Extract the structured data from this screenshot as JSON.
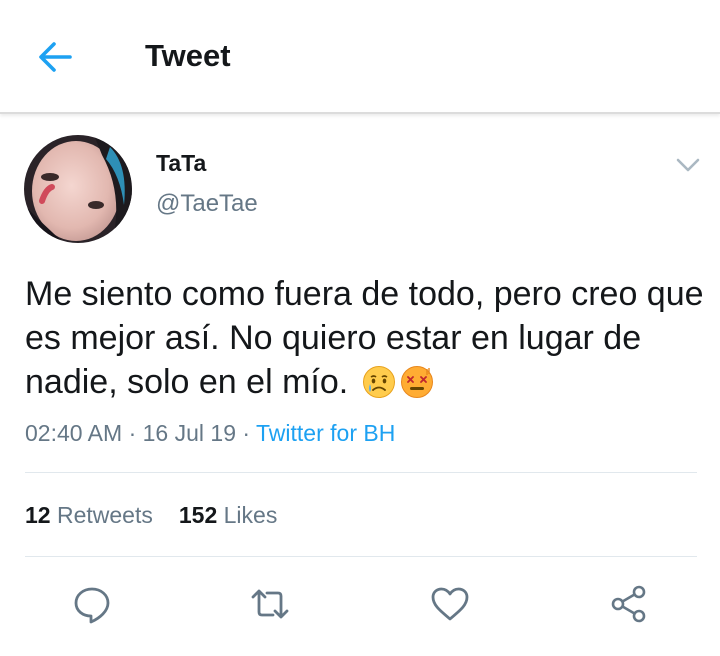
{
  "header": {
    "title": "Tweet",
    "back_icon": "arrow-left-icon",
    "accent": "#1da1f2"
  },
  "tweet": {
    "author": {
      "name": "TaTa",
      "handle": "@TaeTae"
    },
    "text": "Me siento como fuera de todo, pero creo que es mejor así. No quiero estar en lugar de nadie, solo en el mío.",
    "emojis": [
      "crying-face-emoji",
      "dizzy-face-emoji"
    ],
    "time": "02:40 AM",
    "sep1": " · ",
    "date": "16 Jul 19",
    "sep2": " · ",
    "source": "Twitter for BH"
  },
  "stats": {
    "retweets_count": "12",
    "retweets_label": "Retweets",
    "likes_count": "152",
    "likes_label": "Likes"
  },
  "actions": [
    "reply-icon",
    "retweet-icon",
    "like-icon",
    "share-icon"
  ],
  "colors": {
    "text": "#14171a",
    "secondary": "#657786",
    "link": "#1da1f2",
    "icon": "#657786"
  }
}
